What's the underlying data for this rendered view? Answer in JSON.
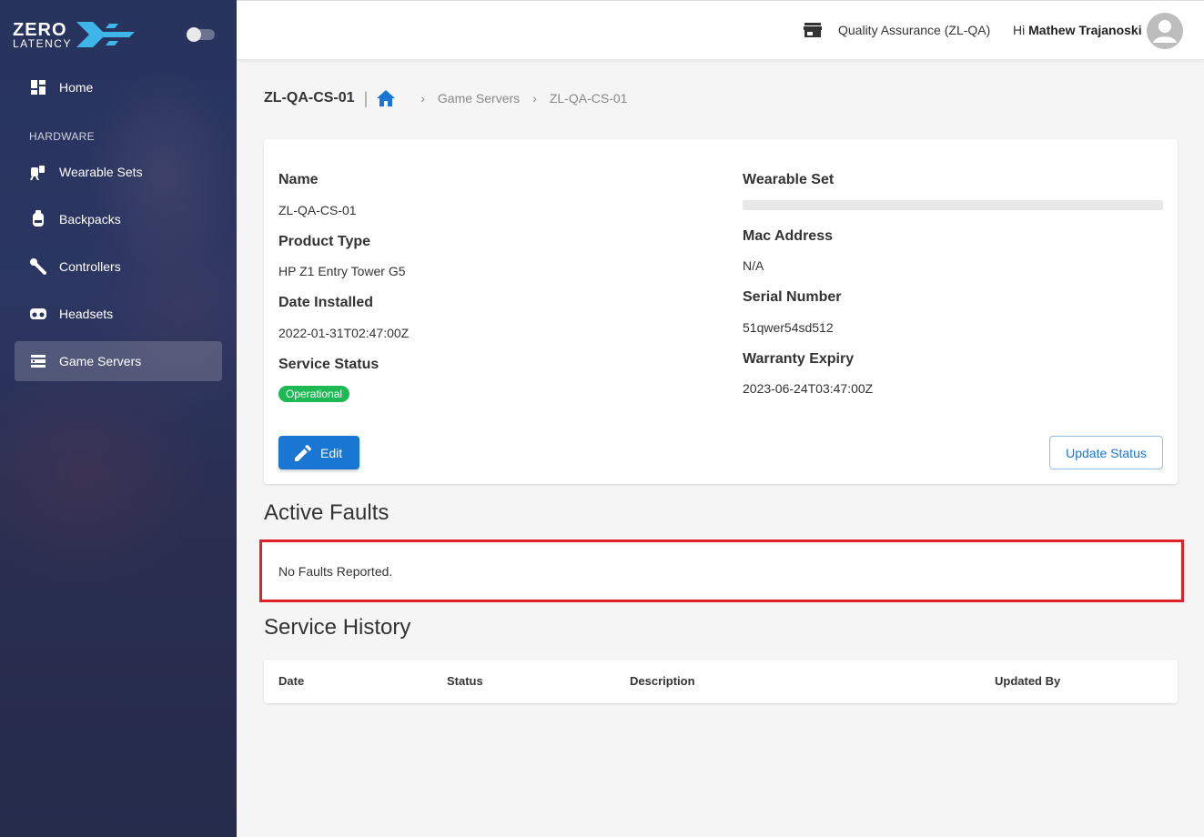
{
  "brand": {
    "line1": "ZERO",
    "line2": "LATENCY"
  },
  "sidebar": {
    "home": "Home",
    "section": "HARDWARE",
    "items": [
      {
        "label": "Wearable Sets",
        "icon": "wearable-set-icon"
      },
      {
        "label": "Backpacks",
        "icon": "backpack-icon"
      },
      {
        "label": "Controllers",
        "icon": "controller-icon"
      },
      {
        "label": "Headsets",
        "icon": "headset-icon"
      },
      {
        "label": "Game Servers",
        "icon": "server-icon",
        "active": true
      }
    ]
  },
  "topbar": {
    "org": "Quality Assurance (ZL-QA)",
    "greeting": "Hi",
    "user": "Mathew Trajanoski"
  },
  "breadcrumb": {
    "title": "ZL-QA-CS-01",
    "items": [
      "Game Servers",
      "ZL-QA-CS-01"
    ]
  },
  "details": {
    "name_label": "Name",
    "name": "ZL-QA-CS-01",
    "product_type_label": "Product Type",
    "product_type": "HP Z1 Entry Tower G5",
    "date_installed_label": "Date Installed",
    "date_installed": "2022-01-31T02:47:00Z",
    "service_status_label": "Service Status",
    "service_status": "Operational",
    "wearable_set_label": "Wearable Set",
    "mac_label": "Mac Address",
    "mac": "N/A",
    "serial_label": "Serial Number",
    "serial": "51qwer54sd512",
    "warranty_label": "Warranty Expiry",
    "warranty": "2023-06-24T03:47:00Z",
    "edit_label": "Edit",
    "update_label": "Update Status"
  },
  "faults": {
    "title": "Active Faults",
    "empty": "No Faults Reported."
  },
  "history": {
    "title": "Service History",
    "columns": [
      "Date",
      "Status",
      "Description",
      "Updated By"
    ]
  },
  "colors": {
    "primary": "#1976d2",
    "operational": "#1db954",
    "highlight": "#e0202a",
    "sidebar": "#27345e"
  }
}
